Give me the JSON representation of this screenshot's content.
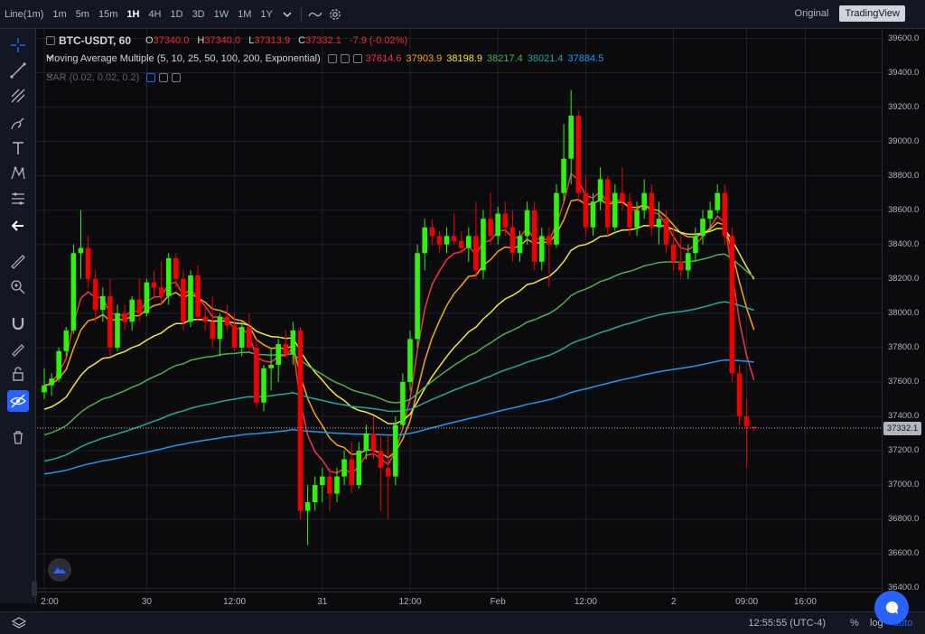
{
  "toolbar": {
    "chart_type": "Line(1m)",
    "intervals": [
      "1m",
      "5m",
      "15m",
      "1H",
      "4H",
      "1D",
      "3D",
      "1W",
      "1M",
      "1Y"
    ],
    "active_interval": "1H",
    "view_original": "Original",
    "view_tradingview": "TradingView"
  },
  "legend": {
    "symbol": "BTC-USDT, 60",
    "open_label": "O",
    "open": "37340.0",
    "high_label": "H",
    "high": "37340.0",
    "low_label": "L",
    "low": "37313.9",
    "close_label": "C",
    "close": "37332.1",
    "change": "-7.9 (-0.02%)",
    "ma_name": "Moving Average Multiple (5, 10, 25, 50, 100, 200, Exponential)",
    "ma_values": [
      {
        "value": "37614.6",
        "color": "#f23645"
      },
      {
        "value": "37903.9",
        "color": "#f7a21b"
      },
      {
        "value": "38198.9",
        "color": "#f0e442"
      },
      {
        "value": "38217.4",
        "color": "#4caf50"
      },
      {
        "value": "38021.4",
        "color": "#26a69a"
      },
      {
        "value": "37884.5",
        "color": "#2196f3"
      }
    ],
    "sar_name": "SAR (0.02, 0.02, 0.2)"
  },
  "colors": {
    "up": "#2ef30a",
    "down": "#f00000",
    "accent": "#2962ff"
  },
  "chart_data": {
    "type": "candlestick",
    "ylim": [
      36380,
      39650
    ],
    "y_ticks": [
      "39600.0",
      "39400.0",
      "39200.0",
      "39000.0",
      "38800.0",
      "38600.0",
      "38400.0",
      "38200.0",
      "38000.0",
      "37800.0",
      "37600.0",
      "37400.0",
      "37200.0",
      "37000.0",
      "36800.0",
      "36600.0",
      "36400.0"
    ],
    "y_tick_values": [
      39600,
      39400,
      39200,
      39000,
      38800,
      38600,
      38400,
      38200,
      38000,
      37800,
      37600,
      37400,
      37200,
      37000,
      36800,
      36600,
      36400
    ],
    "x_ticks": [
      "2:00",
      "30",
      "12:00",
      "31",
      "12:00",
      "Feb",
      "12:00",
      "2",
      "09:00",
      "16:00"
    ],
    "x_tick_index": [
      0,
      14,
      26,
      38,
      50,
      62,
      74,
      86,
      96,
      104
    ],
    "last_price": 37332.1,
    "last_price_label": "37332.1",
    "candles": [
      [
        37540,
        37680,
        37500,
        37580
      ],
      [
        37580,
        37650,
        37520,
        37620
      ],
      [
        37620,
        37800,
        37600,
        37780
      ],
      [
        37780,
        37920,
        37750,
        37900
      ],
      [
        37900,
        38400,
        37880,
        38350
      ],
      [
        38350,
        38600,
        38200,
        38380
      ],
      [
        38380,
        38450,
        38150,
        38200
      ],
      [
        38200,
        38250,
        37950,
        38020
      ],
      [
        38020,
        38150,
        37950,
        38100
      ],
      [
        38100,
        38200,
        37750,
        37800
      ],
      [
        37800,
        38050,
        37780,
        38000
      ],
      [
        38000,
        38050,
        37900,
        37950
      ],
      [
        37950,
        38100,
        37900,
        38080
      ],
      [
        38080,
        38200,
        37950,
        38000
      ],
      [
        38000,
        38200,
        37980,
        38180
      ],
      [
        38180,
        38250,
        38100,
        38150
      ],
      [
        38150,
        38300,
        38050,
        38100
      ],
      [
        38100,
        38350,
        38050,
        38320
      ],
      [
        38320,
        38350,
        38150,
        38200
      ],
      [
        38200,
        38250,
        37900,
        37950
      ],
      [
        37950,
        38250,
        37920,
        38220
      ],
      [
        38220,
        38280,
        37950,
        37980
      ],
      [
        37980,
        38050,
        37900,
        37950
      ],
      [
        37950,
        38100,
        37800,
        37850
      ],
      [
        37850,
        38000,
        37750,
        37980
      ],
      [
        37980,
        38050,
        37900,
        37930
      ],
      [
        37930,
        38000,
        37780,
        37800
      ],
      [
        37800,
        37950,
        37750,
        37920
      ],
      [
        37920,
        38000,
        37780,
        37800
      ],
      [
        37800,
        37850,
        37450,
        37480
      ],
      [
        37480,
        37700,
        37430,
        37680
      ],
      [
        37680,
        37800,
        37550,
        37700
      ],
      [
        37700,
        37850,
        37600,
        37820
      ],
      [
        37820,
        37900,
        37740,
        37760
      ],
      [
        37760,
        37950,
        37700,
        37900
      ],
      [
        37900,
        37920,
        36800,
        36850
      ],
      [
        36850,
        37000,
        36650,
        36900
      ],
      [
        36900,
        37050,
        36850,
        37000
      ],
      [
        37000,
        37100,
        36900,
        37050
      ],
      [
        37050,
        37100,
        36850,
        36950
      ],
      [
        36950,
        37100,
        36900,
        37050
      ],
      [
        37050,
        37200,
        37000,
        37150
      ],
      [
        37150,
        37250,
        36950,
        37000
      ],
      [
        37000,
        37250,
        36980,
        37200
      ],
      [
        37200,
        37350,
        37150,
        37300
      ],
      [
        37300,
        37400,
        37150,
        37200
      ],
      [
        37200,
        37300,
        36850,
        37100
      ],
      [
        37100,
        37300,
        36800,
        37050
      ],
      [
        37050,
        37400,
        37000,
        37350
      ],
      [
        37350,
        37650,
        37330,
        37600
      ],
      [
        37600,
        37900,
        37550,
        37850
      ],
      [
        37850,
        38400,
        37800,
        38350
      ],
      [
        38350,
        38550,
        38250,
        38500
      ],
      [
        38500,
        38550,
        38400,
        38450
      ],
      [
        38450,
        38480,
        38350,
        38400
      ],
      [
        38400,
        38500,
        38350,
        38450
      ],
      [
        38450,
        38580,
        38400,
        38420
      ],
      [
        38420,
        38480,
        38350,
        38380
      ],
      [
        38380,
        38500,
        38300,
        38450
      ],
      [
        38450,
        38650,
        38200,
        38250
      ],
      [
        38250,
        38600,
        38200,
        38550
      ],
      [
        38550,
        38700,
        38400,
        38450
      ],
      [
        38450,
        38620,
        38400,
        38580
      ],
      [
        38580,
        38650,
        38450,
        38500
      ],
      [
        38500,
        38600,
        38300,
        38350
      ],
      [
        38350,
        38480,
        38300,
        38450
      ],
      [
        38450,
        38650,
        38400,
        38600
      ],
      [
        38600,
        38650,
        38250,
        38300
      ],
      [
        38300,
        38500,
        38250,
        38450
      ],
      [
        38450,
        38500,
        38150,
        38400
      ],
      [
        38400,
        38750,
        38380,
        38700
      ],
      [
        38700,
        39100,
        38650,
        38900
      ],
      [
        38900,
        39300,
        38750,
        39150
      ],
      [
        39150,
        39180,
        38650,
        38700
      ],
      [
        38700,
        38800,
        38450,
        38500
      ],
      [
        38500,
        38700,
        38450,
        38650
      ],
      [
        38650,
        38850,
        38600,
        38780
      ],
      [
        38780,
        38800,
        38450,
        38500
      ],
      [
        38500,
        38750,
        38480,
        38700
      ],
      [
        38700,
        38850,
        38600,
        38650
      ],
      [
        38650,
        38700,
        38450,
        38500
      ],
      [
        38500,
        38650,
        38450,
        38600
      ],
      [
        38600,
        38780,
        38550,
        38700
      ],
      [
        38700,
        38750,
        38450,
        38500
      ],
      [
        38500,
        38650,
        38400,
        38550
      ],
      [
        38550,
        38600,
        38350,
        38400
      ],
      [
        38400,
        38500,
        38250,
        38300
      ],
      [
        38300,
        38450,
        38200,
        38250
      ],
      [
        38250,
        38400,
        38200,
        38350
      ],
      [
        38350,
        38500,
        38300,
        38450
      ],
      [
        38450,
        38600,
        38400,
        38550
      ],
      [
        38550,
        38650,
        38480,
        38600
      ],
      [
        38600,
        38750,
        38580,
        38700
      ],
      [
        38700,
        38750,
        38400,
        38450
      ],
      [
        38450,
        38500,
        37600,
        37650
      ],
      [
        37650,
        37700,
        37350,
        37400
      ],
      [
        37400,
        37500,
        37100,
        37340
      ],
      [
        37340,
        37340,
        37313.9,
        37332.1
      ]
    ],
    "ema_periods": [
      5,
      10,
      25,
      50,
      100,
      200
    ],
    "ema_colors": [
      "#f23645",
      "#f7a21b",
      "#f0e442",
      "#4caf50",
      "#26a69a",
      "#2196f3"
    ]
  },
  "axis_controls": {
    "percent": "%",
    "log": "log",
    "auto": "auto"
  },
  "clock": "12:55:55 (UTC-4)"
}
